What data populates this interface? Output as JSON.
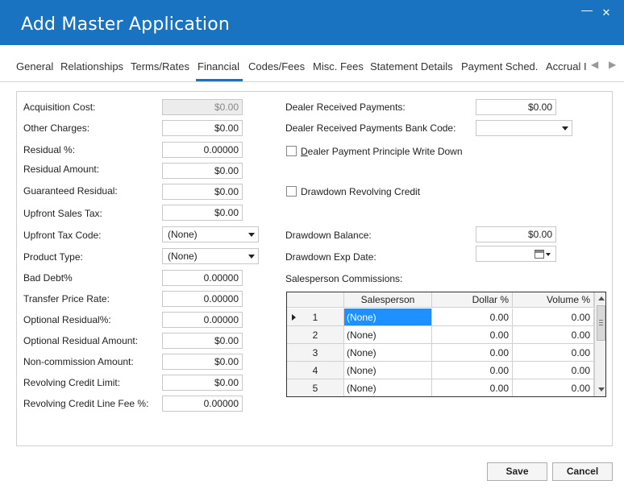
{
  "window": {
    "title": "Add Master Application",
    "minimize_icon": "minimize-icon",
    "close_icon": "close-icon"
  },
  "tabs": [
    {
      "label": "General"
    },
    {
      "label": "Relationships"
    },
    {
      "label": "Terms/Rates"
    },
    {
      "label": "Financial",
      "active": true
    },
    {
      "label": "Codes/Fees"
    },
    {
      "label": "Misc. Fees"
    },
    {
      "label": "Statement Details"
    },
    {
      "label": "Payment Sched."
    },
    {
      "label": "Accrual I"
    }
  ],
  "left": {
    "acquisition_cost": {
      "label": "Acquisition Cost:",
      "value": "$0.00"
    },
    "other_charges": {
      "label": "Other Charges:",
      "value": "$0.00"
    },
    "residual_pct": {
      "label": "Residual %:",
      "value": "0.00000"
    },
    "residual_amount": {
      "label": "Residual Amount:",
      "value": "$0.00"
    },
    "guaranteed_residual": {
      "label": "Guaranteed Residual:",
      "value": "$0.00"
    },
    "upfront_sales_tax": {
      "label": "Upfront Sales Tax:",
      "value": "$0.00"
    },
    "upfront_tax_code": {
      "label": "Upfront Tax Code:",
      "value": "(None)"
    },
    "product_type": {
      "label": "Product Type:",
      "value": "(None)"
    },
    "bad_debt": {
      "label": "Bad Debt%",
      "value": "0.00000"
    },
    "transfer_price_rate": {
      "label": "Transfer Price Rate:",
      "value": "0.00000"
    },
    "optional_residual_pct": {
      "label": "Optional Residual%:",
      "value": "0.00000"
    },
    "optional_residual_amount": {
      "label": "Optional Residual Amount:",
      "value": "$0.00"
    },
    "non_commission_amount": {
      "label": "Non-commission Amount:",
      "value": "$0.00"
    },
    "revolving_credit_limit": {
      "label": "Revolving Credit Limit:",
      "value": "$0.00"
    },
    "revolving_credit_line_fee": {
      "label": "Revolving Credit Line Fee %:",
      "value": "0.00000"
    }
  },
  "right": {
    "dealer_received_payments": {
      "label": "Dealer Received Payments:",
      "value": "$0.00"
    },
    "dealer_received_payments_bank_code": {
      "label": "Dealer Received Payments Bank Code:",
      "value": ""
    },
    "dealer_payment_principle_write_down": {
      "label": "Dealer Payment Principle Write Down",
      "checked": false
    },
    "drawdown_revolving_credit": {
      "label": "Drawdown Revolving Credit",
      "checked": false
    },
    "drawdown_balance": {
      "label": "Drawdown Balance:",
      "value": "$0.00"
    },
    "drawdown_exp_date": {
      "label": "Drawdown Exp Date:",
      "value": "",
      "icon": "calendar-icon"
    },
    "salesperson_commissions_label": "Salesperson Commissions:"
  },
  "commissions_grid": {
    "columns": [
      "Salesperson",
      "Dollar %",
      "Volume %"
    ],
    "rows": [
      {
        "num": "1",
        "salesperson": "(None)",
        "dollar": "0.00",
        "volume": "0.00"
      },
      {
        "num": "2",
        "salesperson": "(None)",
        "dollar": "0.00",
        "volume": "0.00"
      },
      {
        "num": "3",
        "salesperson": "(None)",
        "dollar": "0.00",
        "volume": "0.00"
      },
      {
        "num": "4",
        "salesperson": "(None)",
        "dollar": "0.00",
        "volume": "0.00"
      },
      {
        "num": "5",
        "salesperson": "(None)",
        "dollar": "0.00",
        "volume": "0.00"
      }
    ]
  },
  "footer": {
    "save_label": "Save",
    "cancel_label": "Cancel"
  }
}
